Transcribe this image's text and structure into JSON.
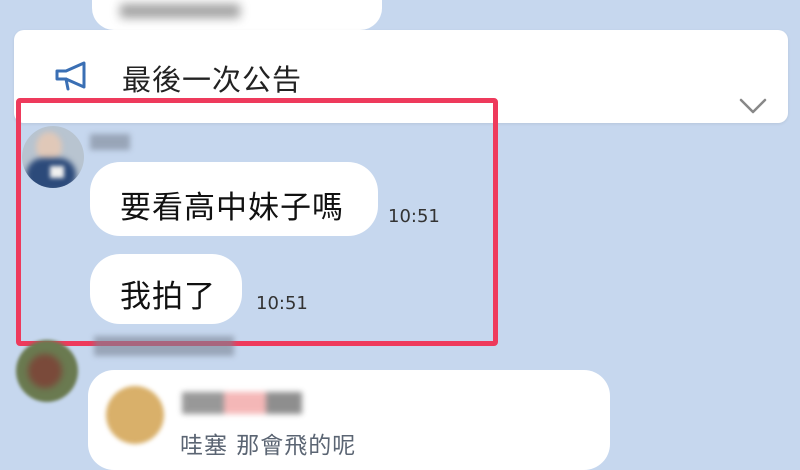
{
  "announcement": {
    "title": "最後一次公告",
    "icon": "megaphone-icon",
    "toggle_icon": "chevron-down-icon"
  },
  "messages": [
    {
      "text": "要看高中妹子嗎",
      "time": "10:51"
    },
    {
      "text": "我拍了",
      "time": "10:51"
    }
  ],
  "reply_preview": {
    "text": "哇塞 那會飛的呢"
  },
  "colors": {
    "background": "#c6d7ee",
    "bubble": "#ffffff",
    "highlight": "#ee3a5c"
  }
}
